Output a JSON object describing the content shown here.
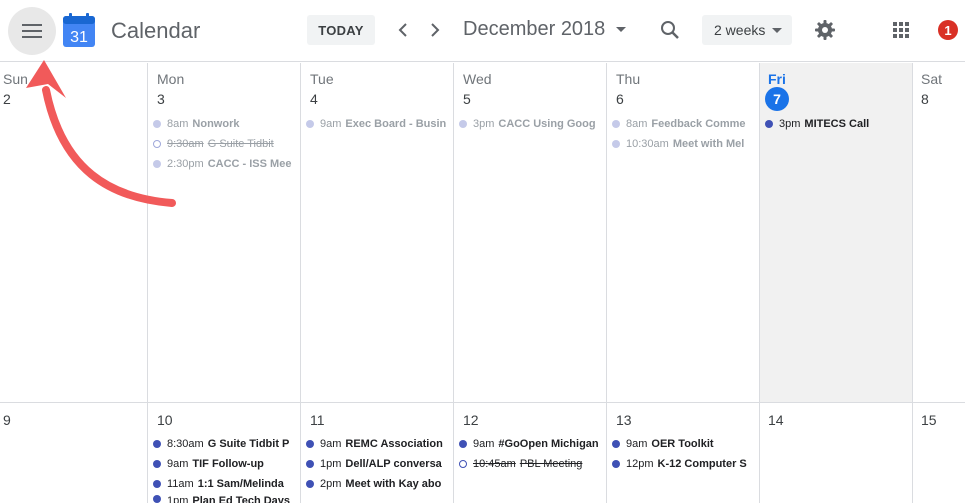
{
  "header": {
    "app_title": "Calendar",
    "logo_number": "31",
    "today_label": "TODAY",
    "month_label": "December 2018",
    "view_label": "2 weeks",
    "notification_count": "1"
  },
  "icons": [
    "menu-icon",
    "calendar-logo-icon",
    "chevron-left-icon",
    "chevron-right-icon",
    "search-icon",
    "gear-icon",
    "apps-grid-icon"
  ],
  "colors": {
    "accent": "#1a73e8",
    "event_blue": "#3f51b5",
    "badge_red": "#d93025",
    "today_bg": "#f1f1f1",
    "annotation_arrow": "#f15a5a"
  },
  "week1": {
    "days": [
      {
        "dow": "Sun",
        "date": "2"
      },
      {
        "dow": "Mon",
        "date": "3"
      },
      {
        "dow": "Tue",
        "date": "4"
      },
      {
        "dow": "Wed",
        "date": "5"
      },
      {
        "dow": "Thu",
        "date": "6"
      },
      {
        "dow": "Fri",
        "date": "7"
      },
      {
        "dow": "Sat",
        "date": "8"
      }
    ]
  },
  "week2": {
    "days": [
      {
        "date": "9"
      },
      {
        "date": "10"
      },
      {
        "date": "11"
      },
      {
        "date": "12"
      },
      {
        "date": "13"
      },
      {
        "date": "14"
      },
      {
        "date": "15"
      }
    ]
  },
  "events": {
    "mon3": [
      {
        "time": "8am",
        "title": "Nonwork"
      },
      {
        "time": "9:30am",
        "title": "G Suite Tidbit"
      },
      {
        "time": "2:30pm",
        "title": "CACC - ISS Mee"
      }
    ],
    "tue4": [
      {
        "time": "9am",
        "title": "Exec Board - Busin"
      }
    ],
    "wed5": [
      {
        "time": "3pm",
        "title": "CACC Using Goog"
      }
    ],
    "thu6": [
      {
        "time": "8am",
        "title": "Feedback Comme"
      },
      {
        "time": "10:30am",
        "title": "Meet with Mel"
      }
    ],
    "fri7": [
      {
        "time": "3pm",
        "title": "MITECS Call"
      }
    ],
    "mon10": [
      {
        "time": "8:30am",
        "title": "G Suite Tidbit P"
      },
      {
        "time": "9am",
        "title": "TIF Follow-up"
      },
      {
        "time": "11am",
        "title": "1:1 Sam/Melinda"
      },
      {
        "time": "1pm",
        "title": "Plan Ed Tech Days"
      }
    ],
    "tue11": [
      {
        "time": "9am",
        "title": "REMC Association"
      },
      {
        "time": "1pm",
        "title": "Dell/ALP conversa"
      },
      {
        "time": "2pm",
        "title": "Meet with Kay abo"
      }
    ],
    "wed12": [
      {
        "time": "9am",
        "title": "#GoOpen Michigan"
      },
      {
        "time": "10:45am",
        "title": "PBL Meeting"
      }
    ],
    "thu13": [
      {
        "time": "9am",
        "title": "OER Toolkit"
      },
      {
        "time": "12pm",
        "title": "K-12 Computer S"
      }
    ]
  }
}
